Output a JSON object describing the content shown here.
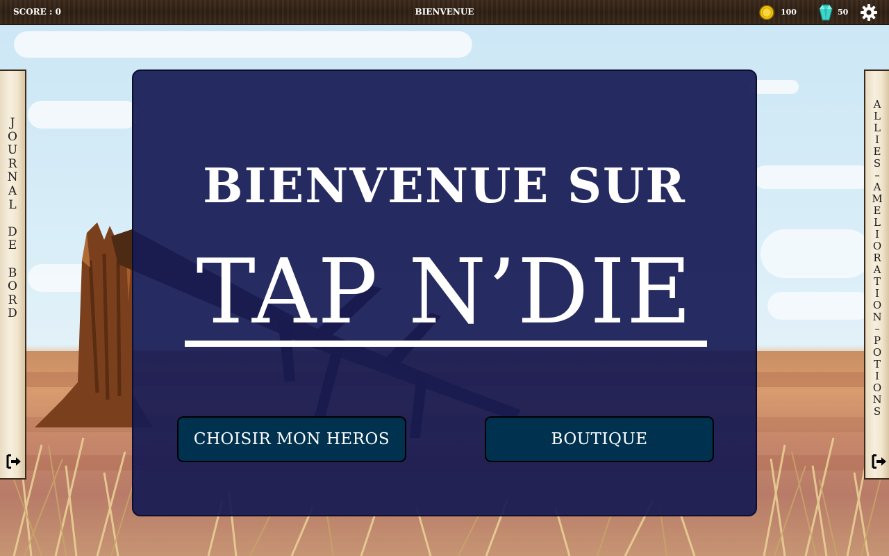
{
  "topbar": {
    "score_label": "SCORE : 0",
    "screen_name": "BIENVENUE",
    "coins": "100",
    "gems": "50"
  },
  "left_panel": {
    "label_lines": [
      "J",
      "O",
      "U",
      "R",
      "N",
      "A",
      "L",
      " ",
      "D",
      "E",
      " ",
      "B",
      "O",
      "R",
      "D"
    ]
  },
  "right_panel": {
    "label_lines": [
      "A",
      "L",
      "L",
      "I",
      "E",
      "S",
      "–",
      "A",
      "M",
      "E",
      "L",
      "I",
      "O",
      "R",
      "A",
      "T",
      "I",
      "O",
      "N",
      "–",
      "P",
      "O",
      "T",
      "I",
      "O",
      "N",
      "S"
    ]
  },
  "dialog": {
    "welcome": "BIENVENUE SUR",
    "game_title": "TAP N’DIE",
    "choose_hero_button": "CHOISIR MON HEROS",
    "shop_button": "BOUTIQUE"
  },
  "icons": {
    "coin": "coin-icon",
    "gem": "gem-icon",
    "settings": "gear-icon",
    "exit": "exit-icon"
  },
  "colors": {
    "dialog_bg": "#161a54",
    "button_bg": "#003250",
    "topbar_bg": "#2e1f14",
    "coin": "#f2c40f",
    "gem": "#3ed6c9"
  }
}
